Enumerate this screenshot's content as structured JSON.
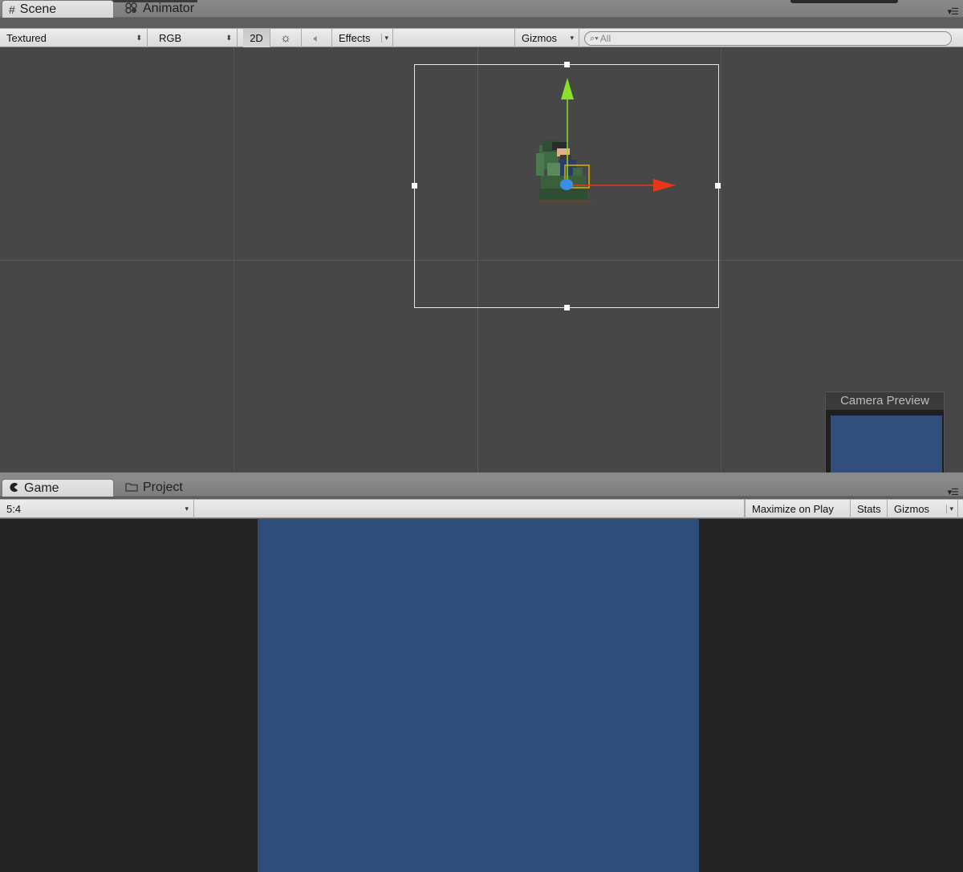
{
  "scene_panel": {
    "tabs": [
      {
        "label": "Scene",
        "icon": "grid-icon",
        "active": true
      },
      {
        "label": "Animator",
        "icon": "animator-icon",
        "active": false
      }
    ],
    "toolbar": {
      "render_mode": "Textured",
      "color_mode": "RGB",
      "mode_2d": "2D",
      "lighting_icon": "sun-icon",
      "audio_icon": "speaker-icon",
      "effects": "Effects",
      "gizmos": "Gizmos",
      "search_placeholder": "All"
    },
    "camera_preview": {
      "title": "Camera Preview",
      "color": "#314e7d"
    }
  },
  "game_panel": {
    "tabs": [
      {
        "label": "Game",
        "icon": "pacman-icon",
        "active": true
      },
      {
        "label": "Project",
        "icon": "folder-icon",
        "active": false
      }
    ],
    "toolbar": {
      "aspect": "5:4",
      "maximize": "Maximize on Play",
      "stats": "Stats",
      "gizmos": "Gizmos"
    },
    "view_color": "#2f4d7a"
  },
  "colors": {
    "scene_bg": "#474747",
    "game_bg": "#242424",
    "y_axis": "#88e02a",
    "x_axis": "#e8361a",
    "pivot": "#3a8ee6"
  }
}
